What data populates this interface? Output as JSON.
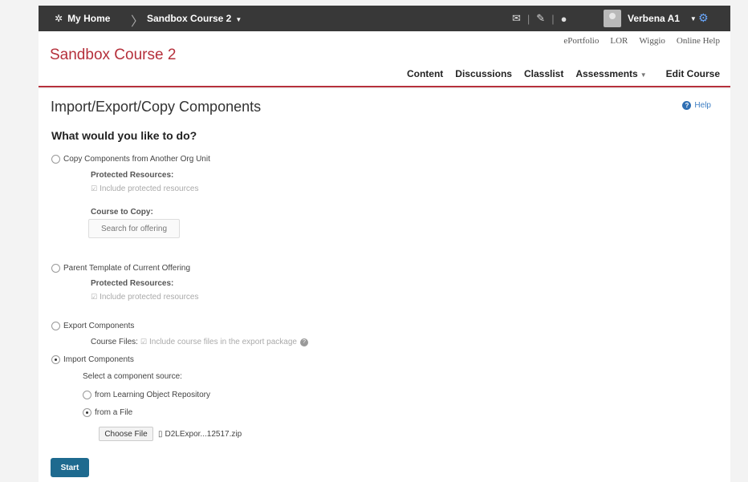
{
  "topbar": {
    "home_label": "My Home",
    "course_label": "Sandbox Course 2",
    "user_name": "Verbena A1"
  },
  "header": {
    "course_title": "Sandbox Course 2",
    "utility_links": [
      "ePortfolio",
      "LOR",
      "Wiggio",
      "Online Help"
    ],
    "nav": [
      "Content",
      "Discussions",
      "Classlist",
      "Assessments",
      "Edit Course"
    ]
  },
  "page": {
    "title": "Import/Export/Copy Components",
    "help_label": "Help",
    "question": "What would you like to do?",
    "copy_option": "Copy Components from Another Org Unit",
    "protected_resources_label": "Protected Resources:",
    "include_protected": "Include protected resources",
    "course_to_copy_label": "Course to Copy:",
    "search_offering": "Search for offering",
    "parent_option": "Parent Template of Current Offering",
    "protected_resources_label_2": "Protected Resources:",
    "include_protected_2": "Include protected resources",
    "export_option": "Export Components",
    "course_files_label": "Course Files:",
    "include_course_files": "Include course files in the export package",
    "import_option": "Import Components",
    "select_source": "Select a component source:",
    "from_lor": "from Learning Object Repository",
    "from_file": "from a File",
    "choose_file": "Choose File",
    "file_name": "D2LExpor...12517.zip",
    "start": "Start"
  },
  "colors": {
    "accent": "#b5303b",
    "topbar": "#383838",
    "start_button": "#1e6a8f"
  }
}
